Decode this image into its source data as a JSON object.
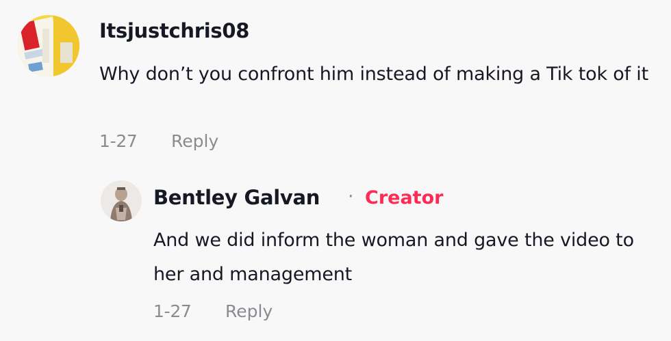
{
  "comments": [
    {
      "username": "Itsjustchris08",
      "text": "Why don’t you confront him instead of making a Tik tok of it",
      "date": "1-27",
      "reply_label": "Reply",
      "avatar": "user-avatar-photo"
    }
  ],
  "reply": {
    "username": "Bentley Galvan",
    "separator": "·",
    "badge": "Creator",
    "text": "And we did inform the woman and gave the video to her and management",
    "date": "1-27",
    "reply_label": "Reply",
    "avatar": "creator-avatar-photo"
  },
  "colors": {
    "background": "#f8f8f8",
    "text": "#161823",
    "meta": "#8a8b91",
    "creator_accent": "#fe2c55"
  }
}
